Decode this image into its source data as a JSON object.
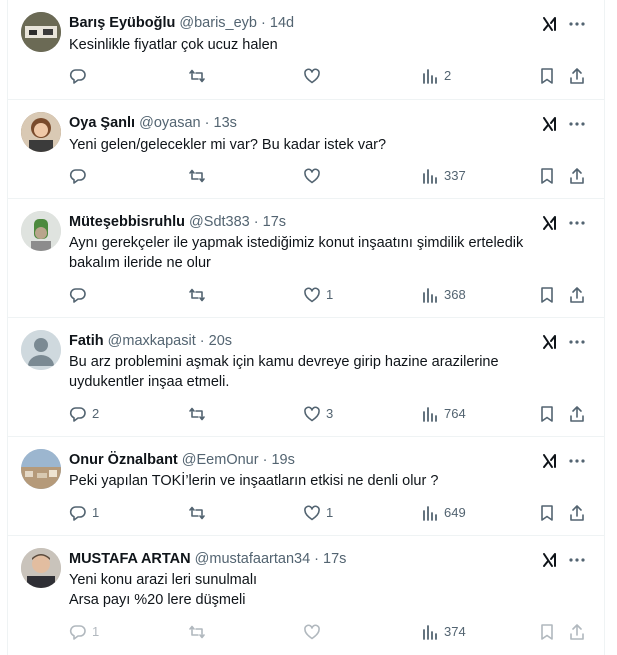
{
  "colors": {
    "text": "#0f1419",
    "secondary": "#536471",
    "border": "#eff3f4"
  },
  "tweets": [
    {
      "name": "Barış Eyüboğlu",
      "handle": "@baris_eyb",
      "dot": "·",
      "time": "14d",
      "lines": [
        "Kesinlikle fiyatlar çok ucuz halen"
      ],
      "reply": "",
      "retweet": "",
      "like": "",
      "views": "2"
    },
    {
      "name": "Oya Şanlı",
      "handle": "@oyasan",
      "dot": "·",
      "time": "13s",
      "lines": [
        "Yeni gelen/gelecekler mi var? Bu kadar istek var?"
      ],
      "reply": "",
      "retweet": "",
      "like": "",
      "views": "337"
    },
    {
      "name": "Müteşebbisruhlu",
      "handle": "@Sdt383",
      "dot": "·",
      "time": "17s",
      "lines": [
        "Aynı gerekçeler ile yapmak istediğimiz konut inşaatını şimdilik erteledik",
        "bakalım ileride ne olur"
      ],
      "reply": "",
      "retweet": "",
      "like": "1",
      "views": "368"
    },
    {
      "name": "Fatih",
      "handle": "@maxkapasit",
      "dot": "·",
      "time": "20s",
      "lines": [
        "Bu arz problemini aşmak için kamu devreye girip hazine arazilerine",
        "uydukentler inşaa etmeli."
      ],
      "reply": "2",
      "retweet": "",
      "like": "3",
      "views": "764"
    },
    {
      "name": "Onur Öznalbant",
      "handle": "@EemOnur",
      "dot": "·",
      "time": "19s",
      "lines": [
        "Peki yapılan TOKİ’lerin ve inşaatların etkisi ne denli olur ?"
      ],
      "reply": "1",
      "retweet": "",
      "like": "1",
      "views": "649"
    },
    {
      "name": "MUSTAFA ARTAN",
      "handle": "@mustafaartan34",
      "dot": "·",
      "time": "17s",
      "lines": [
        "Yeni konu arazi leri sunulmalı",
        "Arsa payı %20 lere düşmeli"
      ],
      "reply": "1",
      "retweet": "",
      "like": "",
      "views": "374"
    }
  ]
}
